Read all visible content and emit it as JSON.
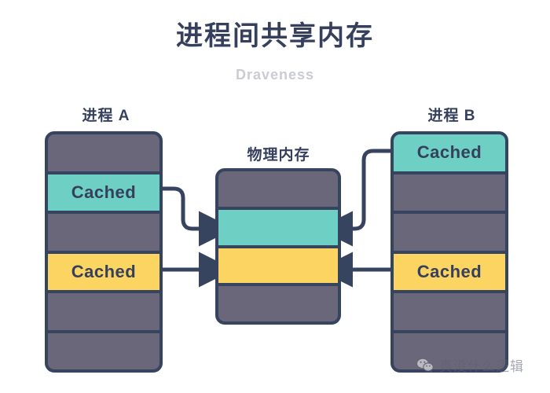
{
  "header": {
    "title": "进程间共享内存",
    "subtitle": "Draveness"
  },
  "diagram": {
    "type": "shared-memory-diagram",
    "columns": [
      {
        "id": "process-a",
        "label": "进程 A",
        "slots": [
          {
            "text": "",
            "fill": "gray"
          },
          {
            "text": "Cached",
            "fill": "teal"
          },
          {
            "text": "",
            "fill": "gray"
          },
          {
            "text": "Cached",
            "fill": "yellow"
          },
          {
            "text": "",
            "fill": "gray"
          },
          {
            "text": "",
            "fill": "gray"
          }
        ]
      },
      {
        "id": "physical-memory",
        "label": "物理内存",
        "slots": [
          {
            "text": "",
            "fill": "gray"
          },
          {
            "text": "",
            "fill": "teal"
          },
          {
            "text": "",
            "fill": "yellow"
          },
          {
            "text": "",
            "fill": "gray"
          }
        ]
      },
      {
        "id": "process-b",
        "label": "进程 B",
        "slots": [
          {
            "text": "Cached",
            "fill": "teal"
          },
          {
            "text": "",
            "fill": "gray"
          },
          {
            "text": "",
            "fill": "gray"
          },
          {
            "text": "Cached",
            "fill": "yellow"
          },
          {
            "text": "",
            "fill": "gray"
          },
          {
            "text": "",
            "fill": "gray"
          }
        ]
      }
    ],
    "connectors": [
      {
        "id": "a-teal-to-mem-teal",
        "from": "process-a.slot-1",
        "to": "physical-memory.slot-1",
        "shape": "s-curve",
        "direction": "right"
      },
      {
        "id": "a-yellow-to-mem-yellow",
        "from": "process-a.slot-3",
        "to": "physical-memory.slot-2",
        "shape": "straight",
        "direction": "right"
      },
      {
        "id": "b-teal-to-mem-teal",
        "from": "process-b.slot-0",
        "to": "physical-memory.slot-1",
        "shape": "s-curve",
        "direction": "left"
      },
      {
        "id": "b-yellow-to-mem-yellow",
        "from": "process-b.slot-3",
        "to": "physical-memory.slot-2",
        "shape": "straight",
        "direction": "left"
      }
    ]
  },
  "watermark": {
    "text": "真没什么逻辑",
    "icon": "wechat-icon"
  },
  "colors": {
    "stroke": "#37445f",
    "gray": "#696779",
    "teal": "#6ecfc4",
    "yellow": "#fbd462",
    "title": "#36405c",
    "subtitle": "#c9ccd4",
    "background": "#ffffff"
  }
}
